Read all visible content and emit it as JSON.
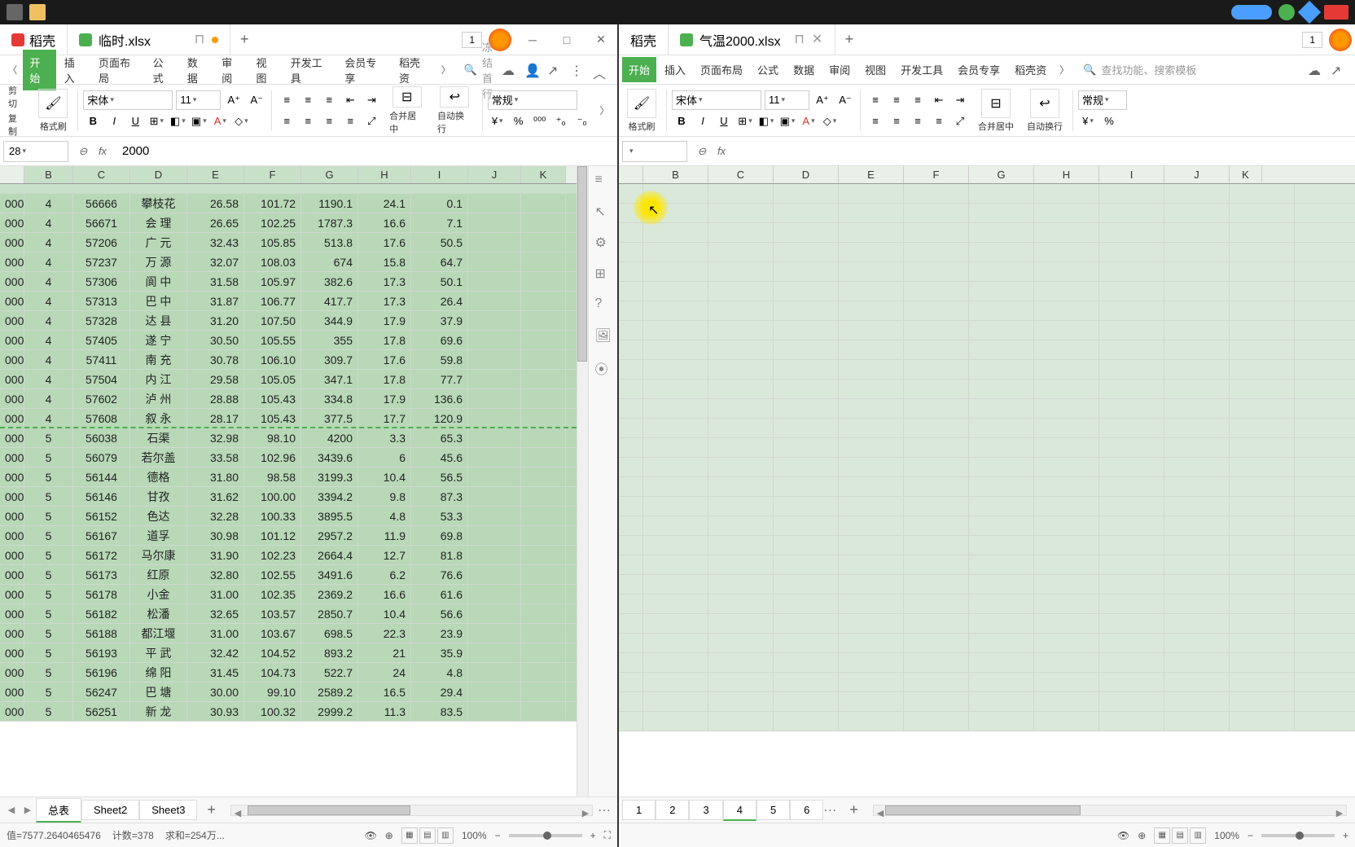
{
  "taskbar": {},
  "leftWindow": {
    "appName": "稻壳",
    "docName": "临时.xlsx",
    "tabCounter": "1",
    "winMin": "─",
    "winMax": "□",
    "winClose": "✕",
    "ribbonTabs": [
      "开始",
      "插入",
      "页面布局",
      "公式",
      "数据",
      "审阅",
      "视图",
      "开发工具",
      "会员专享",
      "稻壳资"
    ],
    "searchPlaceholder": "冻结首行",
    "toolbar": {
      "cut": "剪切",
      "copy": "复制",
      "formatBrush": "格式刷",
      "fontName": "宋体",
      "fontSize": "11",
      "general": "常规",
      "mergeCenter": "合并居中",
      "autoWrap": "自动换行"
    },
    "cellRef": "28",
    "formula": "2000",
    "columns": [
      "B",
      "C",
      "D",
      "E",
      "F",
      "G",
      "H",
      "I",
      "J",
      "K"
    ],
    "rows": [
      {
        "a": "000",
        "b": "4",
        "c": "56666",
        "d": "攀枝花",
        "e": "26.58",
        "f": "101.72",
        "g": "1190.1",
        "h": "24.1",
        "i": "0.1"
      },
      {
        "a": "000",
        "b": "4",
        "c": "56671",
        "d": "会  理",
        "e": "26.65",
        "f": "102.25",
        "g": "1787.3",
        "h": "16.6",
        "i": "7.1"
      },
      {
        "a": "000",
        "b": "4",
        "c": "57206",
        "d": "广  元",
        "e": "32.43",
        "f": "105.85",
        "g": "513.8",
        "h": "17.6",
        "i": "50.5"
      },
      {
        "a": "000",
        "b": "4",
        "c": "57237",
        "d": "万  源",
        "e": "32.07",
        "f": "108.03",
        "g": "674",
        "h": "15.8",
        "i": "64.7"
      },
      {
        "a": "000",
        "b": "4",
        "c": "57306",
        "d": "阆  中",
        "e": "31.58",
        "f": "105.97",
        "g": "382.6",
        "h": "17.3",
        "i": "50.1"
      },
      {
        "a": "000",
        "b": "4",
        "c": "57313",
        "d": "巴  中",
        "e": "31.87",
        "f": "106.77",
        "g": "417.7",
        "h": "17.3",
        "i": "26.4"
      },
      {
        "a": "000",
        "b": "4",
        "c": "57328",
        "d": "达  县",
        "e": "31.20",
        "f": "107.50",
        "g": "344.9",
        "h": "17.9",
        "i": "37.9"
      },
      {
        "a": "000",
        "b": "4",
        "c": "57405",
        "d": "遂  宁",
        "e": "30.50",
        "f": "105.55",
        "g": "355",
        "h": "17.8",
        "i": "69.6"
      },
      {
        "a": "000",
        "b": "4",
        "c": "57411",
        "d": "南  充",
        "e": "30.78",
        "f": "106.10",
        "g": "309.7",
        "h": "17.6",
        "i": "59.8"
      },
      {
        "a": "000",
        "b": "4",
        "c": "57504",
        "d": "内  江",
        "e": "29.58",
        "f": "105.05",
        "g": "347.1",
        "h": "17.8",
        "i": "77.7"
      },
      {
        "a": "000",
        "b": "4",
        "c": "57602",
        "d": "泸  州",
        "e": "28.88",
        "f": "105.43",
        "g": "334.8",
        "h": "17.9",
        "i": "136.6"
      },
      {
        "a": "000",
        "b": "4",
        "c": "57608",
        "d": "叙  永",
        "e": "28.17",
        "f": "105.43",
        "g": "377.5",
        "h": "17.7",
        "i": "120.9",
        "divider": true
      },
      {
        "a": "000",
        "b": "5",
        "c": "56038",
        "d": "石渠",
        "e": "32.98",
        "f": "98.10",
        "g": "4200",
        "h": "3.3",
        "i": "65.3"
      },
      {
        "a": "000",
        "b": "5",
        "c": "56079",
        "d": "若尔盖",
        "e": "33.58",
        "f": "102.96",
        "g": "3439.6",
        "h": "6",
        "i": "45.6"
      },
      {
        "a": "000",
        "b": "5",
        "c": "56144",
        "d": "德格",
        "e": "31.80",
        "f": "98.58",
        "g": "3199.3",
        "h": "10.4",
        "i": "56.5"
      },
      {
        "a": "000",
        "b": "5",
        "c": "56146",
        "d": "甘孜",
        "e": "31.62",
        "f": "100.00",
        "g": "3394.2",
        "h": "9.8",
        "i": "87.3"
      },
      {
        "a": "000",
        "b": "5",
        "c": "56152",
        "d": "色达",
        "e": "32.28",
        "f": "100.33",
        "g": "3895.5",
        "h": "4.8",
        "i": "53.3"
      },
      {
        "a": "000",
        "b": "5",
        "c": "56167",
        "d": "道孚",
        "e": "30.98",
        "f": "101.12",
        "g": "2957.2",
        "h": "11.9",
        "i": "69.8"
      },
      {
        "a": "000",
        "b": "5",
        "c": "56172",
        "d": "马尔康",
        "e": "31.90",
        "f": "102.23",
        "g": "2664.4",
        "h": "12.7",
        "i": "81.8"
      },
      {
        "a": "000",
        "b": "5",
        "c": "56173",
        "d": "红原",
        "e": "32.80",
        "f": "102.55",
        "g": "3491.6",
        "h": "6.2",
        "i": "76.6"
      },
      {
        "a": "000",
        "b": "5",
        "c": "56178",
        "d": "小金",
        "e": "31.00",
        "f": "102.35",
        "g": "2369.2",
        "h": "16.6",
        "i": "61.6"
      },
      {
        "a": "000",
        "b": "5",
        "c": "56182",
        "d": "松潘",
        "e": "32.65",
        "f": "103.57",
        "g": "2850.7",
        "h": "10.4",
        "i": "56.6"
      },
      {
        "a": "000",
        "b": "5",
        "c": "56188",
        "d": "都江堰",
        "e": "31.00",
        "f": "103.67",
        "g": "698.5",
        "h": "22.3",
        "i": "23.9"
      },
      {
        "a": "000",
        "b": "5",
        "c": "56193",
        "d": "平  武",
        "e": "32.42",
        "f": "104.52",
        "g": "893.2",
        "h": "21",
        "i": "35.9"
      },
      {
        "a": "000",
        "b": "5",
        "c": "56196",
        "d": "绵  阳",
        "e": "31.45",
        "f": "104.73",
        "g": "522.7",
        "h": "24",
        "i": "4.8"
      },
      {
        "a": "000",
        "b": "5",
        "c": "56247",
        "d": "巴  塘",
        "e": "30.00",
        "f": "99.10",
        "g": "2589.2",
        "h": "16.5",
        "i": "29.4"
      },
      {
        "a": "000",
        "b": "5",
        "c": "56251",
        "d": "新  龙",
        "e": "30.93",
        "f": "100.32",
        "g": "2999.2",
        "h": "11.3",
        "i": "83.5"
      }
    ],
    "sheetTabs": [
      "总表",
      "Sheet2",
      "Sheet3"
    ],
    "statusBar": {
      "avg": "值=7577.2640465476",
      "count": "计数=378",
      "sum": "求和=254万...",
      "zoom": "100%"
    }
  },
  "rightWindow": {
    "appName": "稻壳",
    "docName": "气温2000.xlsx",
    "tabCounter": "1",
    "ribbonTabs": [
      "开始",
      "插入",
      "页面布局",
      "公式",
      "数据",
      "审阅",
      "视图",
      "开发工具",
      "会员专享",
      "稻壳资"
    ],
    "searchPlaceholder": "查找功能、搜索模板",
    "toolbar": {
      "formatBrush": "格式刷",
      "fontName": "宋体",
      "fontSize": "11",
      "general": "常规",
      "mergeCenter": "合并居中",
      "autoWrap": "自动换行"
    },
    "cellRef": "",
    "formula": "",
    "columns": [
      "B",
      "C",
      "D",
      "E",
      "F",
      "G",
      "H",
      "I",
      "J",
      "K"
    ],
    "sheetTabs": [
      "1",
      "2",
      "3",
      "4",
      "5",
      "6"
    ],
    "activeSheet": "4",
    "statusBar": {
      "zoom": "100%"
    }
  }
}
